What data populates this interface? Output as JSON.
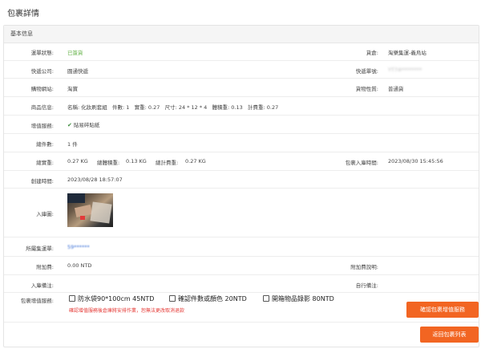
{
  "page": {
    "title": "包裹詳情"
  },
  "section": {
    "title": "基本信息"
  },
  "rows": {
    "status": {
      "label": "運單狀態:",
      "value": "已簽貨"
    },
    "warehouse": {
      "label": "貨倉:",
      "value": "淘樂集運-義烏站"
    },
    "courier": {
      "label": "快遞公司:",
      "value": "圓通快遞"
    },
    "tracking": {
      "label": "快遞單號:",
      "value": "YT74********"
    },
    "shop": {
      "label": "購物網站:",
      "value": "淘寶"
    },
    "cargo_type": {
      "label": "貨物性質:",
      "value": "普通貨"
    },
    "goods": {
      "label": "商品信息:",
      "name_label": "名稱:",
      "name": "化妝刷套組",
      "count_label": "件數:",
      "count": "1",
      "weight_label": "實重:",
      "weight": "0.27",
      "size_label": "尺寸:",
      "size": "24 * 12 * 4",
      "vol_label": "體積重:",
      "vol": "0.13",
      "bill_label": "計費重:",
      "bill": "0.27"
    },
    "added_service": {
      "label": "增值服務:",
      "value": "貼易碎貼紙"
    },
    "pieces": {
      "label": "總件數:",
      "value": "1 件"
    },
    "total_weight": {
      "label": "總實重:",
      "actual": "0.27 KG",
      "vol_label": "總體積重:",
      "vol": "0.13 KG",
      "bill_label": "總計費重:",
      "bill": "0.27 KG"
    },
    "inbound_time": {
      "label": "包裹入庫時間:",
      "value": "2023/08/30 15:45:56"
    },
    "created": {
      "label": "創建時間:",
      "value": "2023/08/28 18:57:07"
    },
    "photo": {
      "label": "入庫圖:"
    },
    "waybill": {
      "label": "所屬集運單:",
      "value": "59******"
    },
    "surcharge": {
      "label": "附加費:",
      "value": "0.00 NTD"
    },
    "surcharge_note": {
      "label": "附加費說明:",
      "value": ""
    },
    "inbound_note": {
      "label": "入庫備注:",
      "value": ""
    },
    "self_note": {
      "label": "自行備注:",
      "value": ""
    },
    "package_services": {
      "label": "包裹增值服務:",
      "options": [
        {
          "label": "防水袋90*100cm 45NTD"
        },
        {
          "label": "確認件數或顏色 20NTD"
        },
        {
          "label": "開箱物品錄影 80NTD"
        }
      ],
      "warning": "確認增值服務後倉庫將安排作業，恕無法更改取消退款"
    }
  },
  "buttons": {
    "confirm": "確認包裹增值服務",
    "back": "返回包裹列表"
  },
  "colors": {
    "accent": "#f26522",
    "status_green": "#67b34a",
    "link": "#3b6fd6",
    "warning": "#e53935"
  }
}
